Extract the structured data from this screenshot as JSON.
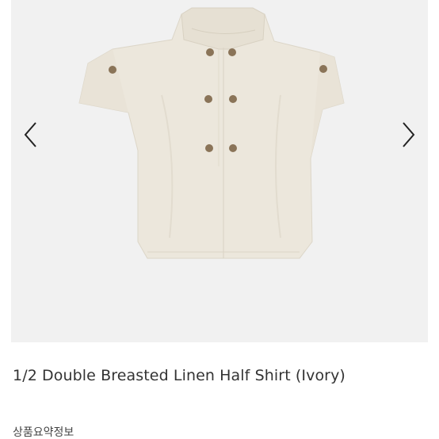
{
  "product": {
    "title": "1/2 Double Breasted Linen Half Shirt (Ivory)",
    "image_icon": "ivory-half-sleeve-shirt-image"
  },
  "gallery": {
    "prev_icon": "chevron-left-icon",
    "next_icon": "chevron-right-icon",
    "background": "#f1f1f1"
  },
  "sections": {
    "summary_label": "상품요약정보"
  },
  "colors": {
    "shirt": "#ece7dc",
    "shirt_shadow": "#ddd7ca",
    "button": "#8a7458",
    "arrow": "#222222",
    "title_text": "#333333"
  }
}
